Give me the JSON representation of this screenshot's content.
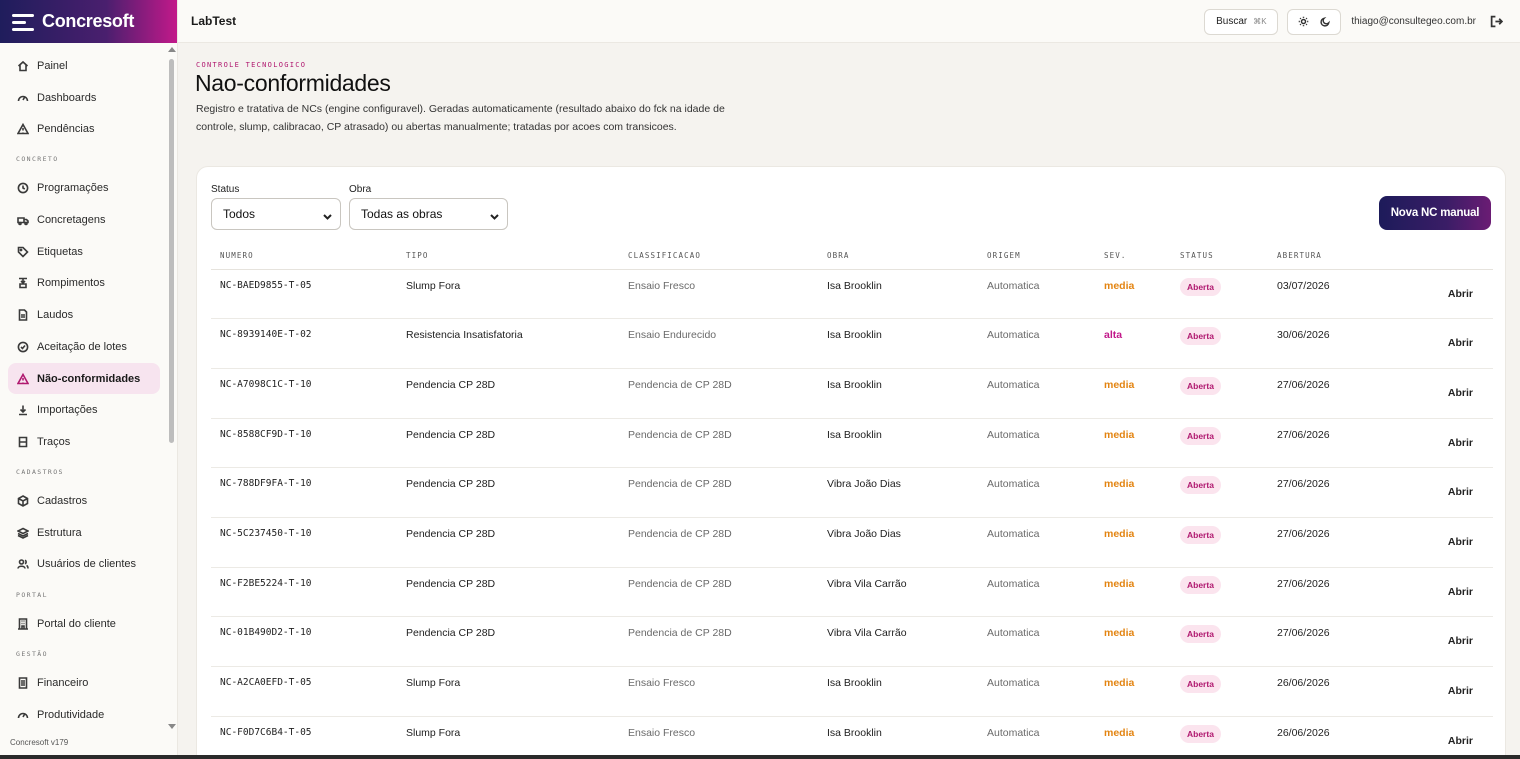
{
  "brand": {
    "name": "Concresoft",
    "version": "Concresoft v179"
  },
  "topbar": {
    "app_title": "LabTest",
    "search_label": "Buscar",
    "search_kbd": "⌘K",
    "user_email": "thiago@consultegeo.com.br"
  },
  "sidebar": {
    "items_top": [
      {
        "label": "Painel",
        "icon": "home-icon"
      },
      {
        "label": "Dashboards",
        "icon": "gauge-icon"
      },
      {
        "label": "Pendências",
        "icon": "alert-triangle-icon"
      }
    ],
    "section_concreto": "CONCRETO",
    "items_concreto": [
      {
        "label": "Programações",
        "icon": "clock-icon"
      },
      {
        "label": "Concretagens",
        "icon": "truck-icon"
      },
      {
        "label": "Etiquetas",
        "icon": "tag-icon"
      },
      {
        "label": "Rompimentos",
        "icon": "press-icon"
      },
      {
        "label": "Laudos",
        "icon": "file-icon"
      },
      {
        "label": "Aceitação de lotes",
        "icon": "check-circle-icon"
      },
      {
        "label": "Não-conformidades",
        "icon": "alert-triangle-icon"
      },
      {
        "label": "Importações",
        "icon": "download-icon"
      },
      {
        "label": "Traços",
        "icon": "columns-icon"
      }
    ],
    "section_cadastros": "CADASTROS",
    "items_cadastros": [
      {
        "label": "Cadastros",
        "icon": "box-icon"
      },
      {
        "label": "Estrutura",
        "icon": "layers-icon"
      },
      {
        "label": "Usuários de clientes",
        "icon": "users-icon"
      }
    ],
    "section_portal": "PORTAL",
    "items_portal": [
      {
        "label": "Portal do cliente",
        "icon": "building-icon"
      }
    ],
    "section_gestao": "GESTÃO",
    "items_gestao": [
      {
        "label": "Financeiro",
        "icon": "receipt-icon"
      },
      {
        "label": "Produtividade",
        "icon": "gauge-icon"
      }
    ]
  },
  "page": {
    "eyebrow": "CONTROLE TECNOLOGICO",
    "title": "Nao-conformidades",
    "description": "Registro e tratativa de NCs (engine configuravel). Geradas automaticamente (resultado abaixo do fck na idade de controle, slump, calibracao, CP atrasado) ou abertas manualmente; tratadas por acoes com transicoes."
  },
  "filters": {
    "status_label": "Status",
    "status_value": "Todos",
    "obra_label": "Obra",
    "obra_value": "Todas as obras",
    "new_button": "Nova NC manual"
  },
  "table": {
    "headers": [
      "NUMERO",
      "TIPO",
      "CLASSIFICACAO",
      "OBRA",
      "ORIGEM",
      "SEV.",
      "STATUS",
      "ABERTURA"
    ],
    "action_label": "Abrir",
    "rows": [
      {
        "numero": "NC-BAED9855-T-05",
        "tipo": "Slump Fora",
        "classificacao": "Ensaio Fresco",
        "obra": "Isa Brooklin",
        "origem": "Automatica",
        "sev": "media",
        "status": "Aberta",
        "abertura": "03/07/2026"
      },
      {
        "numero": "NC-8939140E-T-02",
        "tipo": "Resistencia Insatisfatoria",
        "classificacao": "Ensaio Endurecido",
        "obra": "Isa Brooklin",
        "origem": "Automatica",
        "sev": "alta",
        "status": "Aberta",
        "abertura": "30/06/2026"
      },
      {
        "numero": "NC-A7098C1C-T-10",
        "tipo": "Pendencia CP 28D",
        "classificacao": "Pendencia de CP 28D",
        "obra": "Isa Brooklin",
        "origem": "Automatica",
        "sev": "media",
        "status": "Aberta",
        "abertura": "27/06/2026"
      },
      {
        "numero": "NC-8588CF9D-T-10",
        "tipo": "Pendencia CP 28D",
        "classificacao": "Pendencia de CP 28D",
        "obra": "Isa Brooklin",
        "origem": "Automatica",
        "sev": "media",
        "status": "Aberta",
        "abertura": "27/06/2026"
      },
      {
        "numero": "NC-788DF9FA-T-10",
        "tipo": "Pendencia CP 28D",
        "classificacao": "Pendencia de CP 28D",
        "obra": "Vibra João Dias",
        "origem": "Automatica",
        "sev": "media",
        "status": "Aberta",
        "abertura": "27/06/2026"
      },
      {
        "numero": "NC-5C237450-T-10",
        "tipo": "Pendencia CP 28D",
        "classificacao": "Pendencia de CP 28D",
        "obra": "Vibra João Dias",
        "origem": "Automatica",
        "sev": "media",
        "status": "Aberta",
        "abertura": "27/06/2026"
      },
      {
        "numero": "NC-F2BE5224-T-10",
        "tipo": "Pendencia CP 28D",
        "classificacao": "Pendencia de CP 28D",
        "obra": "Vibra Vila Carrão",
        "origem": "Automatica",
        "sev": "media",
        "status": "Aberta",
        "abertura": "27/06/2026"
      },
      {
        "numero": "NC-01B490D2-T-10",
        "tipo": "Pendencia CP 28D",
        "classificacao": "Pendencia de CP 28D",
        "obra": "Vibra Vila Carrão",
        "origem": "Automatica",
        "sev": "media",
        "status": "Aberta",
        "abertura": "27/06/2026"
      },
      {
        "numero": "NC-A2CA0EFD-T-05",
        "tipo": "Slump Fora",
        "classificacao": "Ensaio Fresco",
        "obra": "Isa Brooklin",
        "origem": "Automatica",
        "sev": "media",
        "status": "Aberta",
        "abertura": "26/06/2026"
      },
      {
        "numero": "NC-F0D7C6B4-T-05",
        "tipo": "Slump Fora",
        "classificacao": "Ensaio Fresco",
        "obra": "Isa Brooklin",
        "origem": "Automatica",
        "sev": "media",
        "status": "Aberta",
        "abertura": "26/06/2026"
      }
    ]
  },
  "colors": {
    "accent": "#b0186f",
    "brand_dark": "#1f1d5c",
    "sev_media": "#e38411",
    "sev_alta": "#c2198a"
  }
}
